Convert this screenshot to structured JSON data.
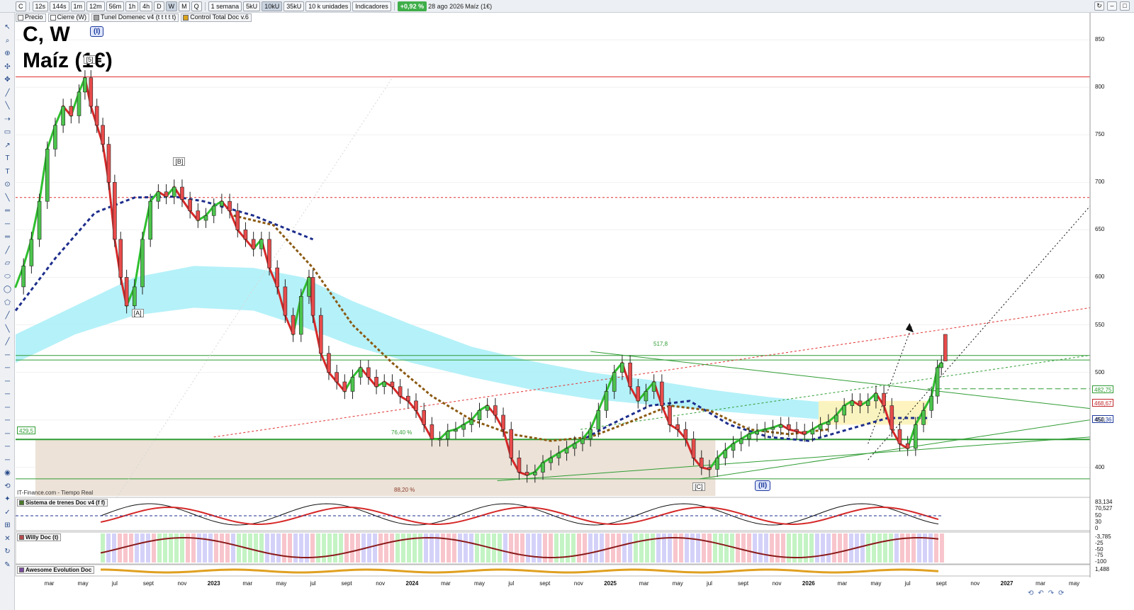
{
  "toolbar": {
    "symbol": "C",
    "periods": [
      "12s",
      "144s",
      "1m",
      "12m",
      "56m",
      "1h",
      "4h",
      "D",
      "W",
      "M",
      "Q"
    ],
    "active_period": "W",
    "timeframe": "1 semana",
    "volume_buttons": [
      "5kU",
      "10kU",
      "35kU"
    ],
    "active_volume": "10kU",
    "units": "10 k unidades",
    "indicators_label": "Indicadores",
    "change": "+0,92 %",
    "date": "28 ago 2026",
    "instrument": "Maíz (1€)"
  },
  "indicator_bar": [
    {
      "label": "Precio",
      "color": "#ffffff"
    },
    {
      "label": "Cierre (W)",
      "color": "#ffffff"
    },
    {
      "label": "Tunel Domenec v4 (t t t t t)",
      "color": "#a0a0a0"
    },
    {
      "label": "Control Total Doc v.6",
      "color": "#d9a21b"
    }
  ],
  "title": {
    "main": "C, W",
    "sub": "Maíz (1€)"
  },
  "waves": {
    "i": "(I)",
    "ii": "(II)"
  },
  "wave_labels": [
    {
      "text": "[5]",
      "x": 2022.37,
      "y": 829
    },
    {
      "text": "[A]",
      "x": 2022.61,
      "y": 562
    },
    {
      "text": "[B]",
      "x": 2022.82,
      "y": 722
    },
    {
      "text": "[C]",
      "x": 2025.44,
      "y": 380
    }
  ],
  "source": "IT-Finance.com - Tiempo Real",
  "levels": {
    "fib_76": "76,40 %",
    "fib_88": "88,20 %",
    "high_label": "517,8",
    "support": "429,5"
  },
  "price_tags": [
    {
      "value": "482,75",
      "price": 482.75,
      "color": "#2f9c33"
    },
    {
      "value": "468,67",
      "price": 468.67,
      "color": "#c0282b"
    },
    {
      "value": "451,36",
      "price": 451.36,
      "color": "#1d3a9c"
    }
  ],
  "panels": [
    {
      "name": "Sistema de trenes Doc v4 (f f)",
      "color": "#4a7a2a",
      "ticks": [
        "83,134",
        "70,527",
        "50",
        "30",
        "0"
      ]
    },
    {
      "name": "Willy Doc (t)",
      "color": "#b54a4a",
      "ticks": [
        "-3,785",
        "-25",
        "-50",
        "-75",
        "-100"
      ]
    },
    {
      "name": "Awesome Evolution Doc",
      "color": "#7a4a9c",
      "ticks": [
        "1,488"
      ]
    }
  ],
  "colors": {
    "bull": "#2fbf2f",
    "bear": "#d62828",
    "ema_blue": "#1d2e8c",
    "ema_brown": "#8b5a12",
    "cloud": "#a8eef8",
    "support_box": "#eadfd3"
  },
  "chart_data": {
    "type": "line",
    "title": "C, W",
    "subtitle": "Maíz (1€)",
    "ylim": [
      370,
      868
    ],
    "xlim": [
      2022.0,
      2027.42
    ],
    "y_ticks": [
      400,
      450,
      500,
      550,
      600,
      650,
      700,
      750,
      800,
      850
    ],
    "x_ticks": [
      {
        "label": "mar",
        "x": 2022.17
      },
      {
        "label": "may",
        "x": 2022.34
      },
      {
        "label": "jul",
        "x": 2022.5
      },
      {
        "label": "sept",
        "x": 2022.67
      },
      {
        "label": "nov",
        "x": 2022.84
      },
      {
        "label": "2023",
        "x": 2023.0,
        "year": true
      },
      {
        "label": "mar",
        "x": 2023.17
      },
      {
        "label": "may",
        "x": 2023.34
      },
      {
        "label": "jul",
        "x": 2023.5
      },
      {
        "label": "sept",
        "x": 2023.67
      },
      {
        "label": "nov",
        "x": 2023.84
      },
      {
        "label": "2024",
        "x": 2024.0,
        "year": true
      },
      {
        "label": "mar",
        "x": 2024.17
      },
      {
        "label": "may",
        "x": 2024.34
      },
      {
        "label": "jul",
        "x": 2024.5
      },
      {
        "label": "sept",
        "x": 2024.67
      },
      {
        "label": "nov",
        "x": 2024.84
      },
      {
        "label": "2025",
        "x": 2025.0,
        "year": true
      },
      {
        "label": "mar",
        "x": 2025.17
      },
      {
        "label": "may",
        "x": 2025.34
      },
      {
        "label": "jul",
        "x": 2025.5
      },
      {
        "label": "sept",
        "x": 2025.67
      },
      {
        "label": "nov",
        "x": 2025.84
      },
      {
        "label": "2026",
        "x": 2026.0,
        "year": true
      },
      {
        "label": "mar",
        "x": 2026.17
      },
      {
        "label": "may",
        "x": 2026.34
      },
      {
        "label": "jul",
        "x": 2026.5
      },
      {
        "label": "sept",
        "x": 2026.67
      },
      {
        "label": "nov",
        "x": 2026.84
      },
      {
        "label": "2027",
        "x": 2027.0,
        "year": true
      },
      {
        "label": "mar",
        "x": 2027.17
      },
      {
        "label": "may",
        "x": 2027.34
      }
    ],
    "price_path": [
      [
        2022.0,
        590
      ],
      [
        2022.04,
        612
      ],
      [
        2022.08,
        640
      ],
      [
        2022.12,
        680
      ],
      [
        2022.16,
        735
      ],
      [
        2022.2,
        760
      ],
      [
        2022.24,
        780
      ],
      [
        2022.28,
        770
      ],
      [
        2022.32,
        795
      ],
      [
        2022.35,
        810
      ],
      [
        2022.38,
        780
      ],
      [
        2022.41,
        760
      ],
      [
        2022.44,
        740
      ],
      [
        2022.47,
        700
      ],
      [
        2022.5,
        640
      ],
      [
        2022.53,
        600
      ],
      [
        2022.56,
        570
      ],
      [
        2022.6,
        590
      ],
      [
        2022.64,
        640
      ],
      [
        2022.68,
        680
      ],
      [
        2022.72,
        690
      ],
      [
        2022.76,
        685
      ],
      [
        2022.8,
        695
      ],
      [
        2022.84,
        682
      ],
      [
        2022.88,
        670
      ],
      [
        2022.92,
        660
      ],
      [
        2022.96,
        665
      ],
      [
        2023.0,
        675
      ],
      [
        2023.04,
        680
      ],
      [
        2023.08,
        670
      ],
      [
        2023.12,
        650
      ],
      [
        2023.16,
        640
      ],
      [
        2023.2,
        630
      ],
      [
        2023.24,
        640
      ],
      [
        2023.28,
        610
      ],
      [
        2023.32,
        590
      ],
      [
        2023.36,
        560
      ],
      [
        2023.4,
        540
      ],
      [
        2023.44,
        580
      ],
      [
        2023.48,
        600
      ],
      [
        2023.5,
        560
      ],
      [
        2023.54,
        520
      ],
      [
        2023.58,
        500
      ],
      [
        2023.62,
        490
      ],
      [
        2023.66,
        480
      ],
      [
        2023.7,
        495
      ],
      [
        2023.74,
        505
      ],
      [
        2023.78,
        495
      ],
      [
        2023.82,
        485
      ],
      [
        2023.86,
        490
      ],
      [
        2023.9,
        485
      ],
      [
        2023.94,
        475
      ],
      [
        2023.98,
        470
      ],
      [
        2024.02,
        460
      ],
      [
        2024.06,
        445
      ],
      [
        2024.1,
        430
      ],
      [
        2024.14,
        430
      ],
      [
        2024.18,
        438
      ],
      [
        2024.22,
        440
      ],
      [
        2024.26,
        445
      ],
      [
        2024.3,
        450
      ],
      [
        2024.34,
        460
      ],
      [
        2024.38,
        465
      ],
      [
        2024.42,
        455
      ],
      [
        2024.46,
        440
      ],
      [
        2024.5,
        410
      ],
      [
        2024.54,
        395
      ],
      [
        2024.58,
        392
      ],
      [
        2024.62,
        395
      ],
      [
        2024.66,
        405
      ],
      [
        2024.7,
        410
      ],
      [
        2024.74,
        415
      ],
      [
        2024.78,
        420
      ],
      [
        2024.82,
        425
      ],
      [
        2024.86,
        430
      ],
      [
        2024.9,
        440
      ],
      [
        2024.94,
        460
      ],
      [
        2024.98,
        480
      ],
      [
        2025.02,
        500
      ],
      [
        2025.06,
        510
      ],
      [
        2025.1,
        485
      ],
      [
        2025.14,
        470
      ],
      [
        2025.18,
        480
      ],
      [
        2025.22,
        490
      ],
      [
        2025.26,
        465
      ],
      [
        2025.3,
        445
      ],
      [
        2025.34,
        440
      ],
      [
        2025.38,
        430
      ],
      [
        2025.42,
        410
      ],
      [
        2025.46,
        400
      ],
      [
        2025.5,
        398
      ],
      [
        2025.54,
        410
      ],
      [
        2025.58,
        418
      ],
      [
        2025.62,
        425
      ],
      [
        2025.66,
        430
      ],
      [
        2025.7,
        435
      ],
      [
        2025.74,
        438
      ],
      [
        2025.78,
        440
      ],
      [
        2025.82,
        442
      ],
      [
        2025.86,
        445
      ],
      [
        2025.9,
        440
      ],
      [
        2025.94,
        438
      ],
      [
        2025.98,
        435
      ],
      [
        2026.02,
        440
      ],
      [
        2026.06,
        445
      ],
      [
        2026.1,
        448
      ],
      [
        2026.14,
        455
      ],
      [
        2026.18,
        465
      ],
      [
        2026.22,
        470
      ],
      [
        2026.26,
        465
      ],
      [
        2026.3,
        470
      ],
      [
        2026.34,
        478
      ],
      [
        2026.38,
        465
      ],
      [
        2026.42,
        440
      ],
      [
        2026.46,
        425
      ],
      [
        2026.5,
        420
      ],
      [
        2026.54,
        445
      ],
      [
        2026.58,
        460
      ],
      [
        2026.62,
        475
      ],
      [
        2026.65,
        505
      ],
      [
        2026.67,
        510
      ]
    ],
    "levels": [
      {
        "name": "resistance",
        "price": 811,
        "color": "#e03030",
        "style": "solid"
      },
      {
        "name": "resistance-b",
        "price": 684,
        "color": "#e03030",
        "style": "dashed"
      },
      {
        "name": "high-517",
        "price": 517.8,
        "color": "#2f9c33",
        "style": "solid"
      },
      {
        "name": "mid",
        "price": 513,
        "color": "#2f9c33",
        "style": "solid"
      },
      {
        "name": "support",
        "price": 429.5,
        "color": "#2f9c33",
        "style": "solid"
      },
      {
        "name": "low",
        "price": 388,
        "color": "#2f9c33",
        "style": "solid"
      }
    ]
  }
}
